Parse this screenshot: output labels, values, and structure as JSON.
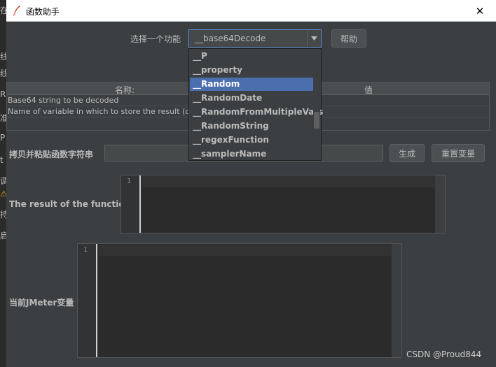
{
  "background": {
    "glyphs": [
      "在",
      "线",
      "线",
      "R",
      "准",
      "P",
      "t",
      "调",
      "⚠",
      "持",
      "启"
    ]
  },
  "dialog": {
    "title": "函数助手",
    "close_glyph": "✕"
  },
  "function_select": {
    "label": "选择一个功能",
    "value": "__base64Decode",
    "help_button": "帮助"
  },
  "dropdown": {
    "items": [
      "__P",
      "__property",
      "__Random",
      "__RandomDate",
      "__RandomFromMultipleVars",
      "__RandomString",
      "__regexFunction",
      "__samplerName"
    ],
    "selected": "__Random"
  },
  "params_table": {
    "columns": [
      "名称:",
      "值"
    ],
    "rows": [
      {
        "name": "Base64 string to be decoded",
        "value": ""
      },
      {
        "name": "Name of variable in which to store the result (op",
        "value": ""
      }
    ]
  },
  "copy_section": {
    "label": "拷贝并粘贴函数字符串",
    "generate_button": "生成",
    "reset_button": "重置变量"
  },
  "result_section": {
    "label": "The result of the function is",
    "line_number": "1"
  },
  "jmeter_vars": {
    "label": "当前JMeter变量",
    "line_number": "1"
  },
  "watermark": "CSDN @Proud844",
  "colors": {
    "accent": "#4b6eaf",
    "focus_border": "#5c8fd6",
    "panel": "#3c3f41",
    "editor": "#2b2b2b"
  }
}
